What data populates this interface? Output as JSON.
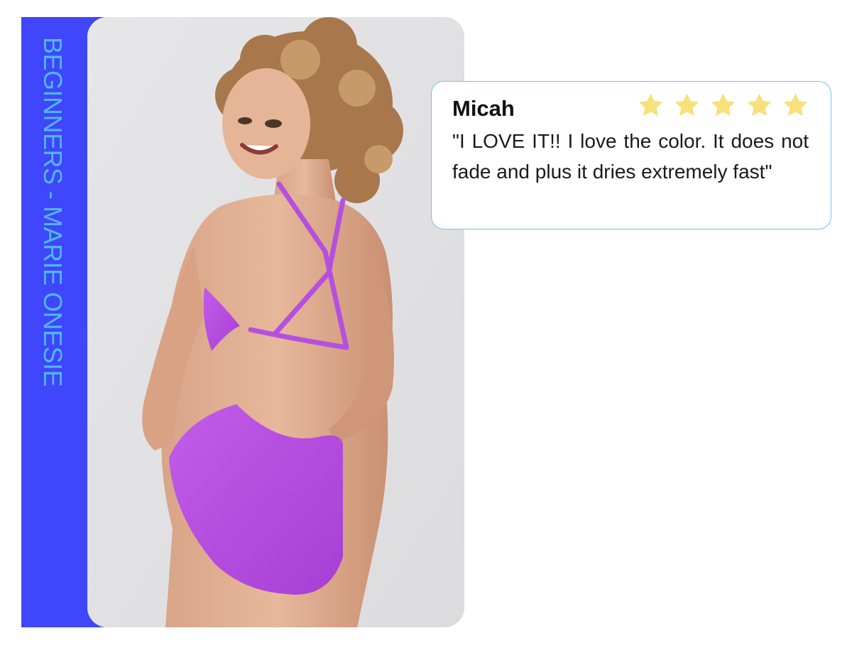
{
  "product": {
    "side_label": "BEGINNERS - MARIE ONESIE",
    "band_color": "#3f46fb",
    "label_color": "#4fb8f2",
    "swimsuit_color": "#b84fe0"
  },
  "review": {
    "name": "Micah",
    "rating": 5,
    "rating_max": 5,
    "star_color": "#f8e07a",
    "text": "\"I LOVE IT!! I love the color. It does not fade and plus it dries extremely fast\""
  }
}
